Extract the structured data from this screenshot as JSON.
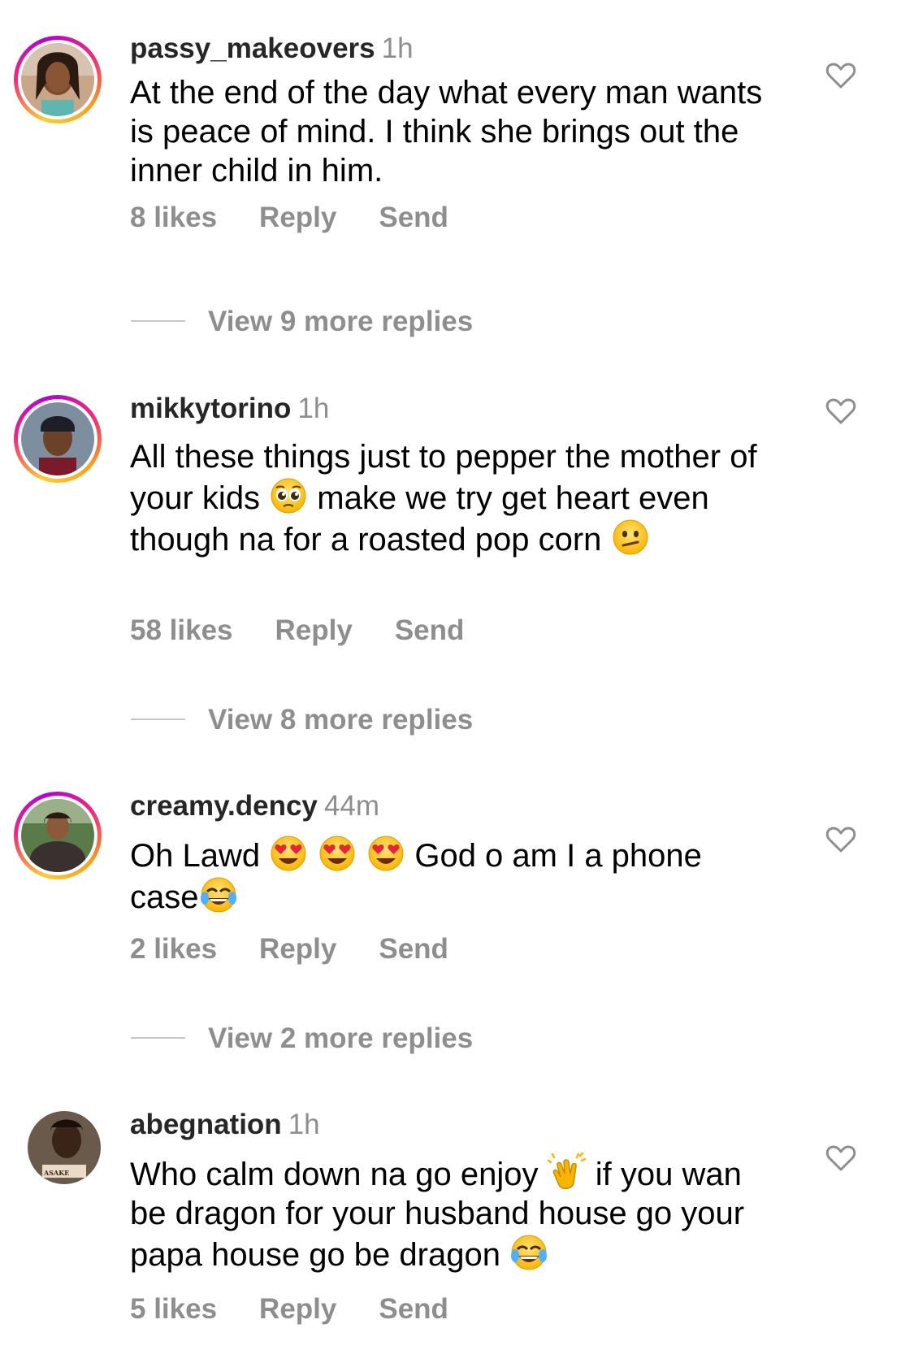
{
  "comments": [
    {
      "username": "passy_makeovers",
      "time": "1h",
      "text_parts": [
        "At the end of the day what every man wants is peace of mind. I think she brings out the inner child in him."
      ],
      "likes": "8 likes",
      "reply": "Reply",
      "send": "Send",
      "view_replies": "View 9 more replies",
      "avatar_story_ring": true
    },
    {
      "username": "mikkytorino",
      "time": "1h",
      "text_parts": [
        "All these things just to pepper the mother of your kids ",
        " make we try get heart even though na for a roasted pop corn "
      ],
      "emojis": [
        "pleading-face-emoji",
        "confused-face-emoji"
      ],
      "likes": "58 likes",
      "reply": "Reply",
      "send": "Send",
      "view_replies": "View 8 more replies",
      "avatar_story_ring": true
    },
    {
      "username": "creamy.dency",
      "time": "44m",
      "text_parts": [
        "Oh Lawd ",
        " God o am I a phone case"
      ],
      "emojis": [
        "heart-eyes-emoji",
        "heart-eyes-emoji",
        "heart-eyes-emoji",
        "tears-of-joy-emoji"
      ],
      "likes": "2 likes",
      "reply": "Reply",
      "send": "Send",
      "view_replies": "View 2 more replies",
      "avatar_story_ring": true
    },
    {
      "username": "abegnation",
      "time": "1h",
      "text_parts": [
        "Who calm down na go enjoy ",
        " if you wan be dragon for your husband house go your papa house go be dragon "
      ],
      "emojis": [
        "clapping-hands-emoji",
        "tears-of-joy-emoji"
      ],
      "avatar_caption": "ASAKE",
      "likes": "5 likes",
      "reply": "Reply",
      "send": "Send",
      "avatar_story_ring": false
    }
  ],
  "colors": {
    "text": "#000000",
    "username": "#262626",
    "secondary": "#8e8e8e",
    "divider": "#c7c7c7",
    "story_ring_start": "#f9ce34",
    "story_ring_end": "#ee2a7b"
  },
  "icons": {
    "like": "heart-outline-icon"
  }
}
